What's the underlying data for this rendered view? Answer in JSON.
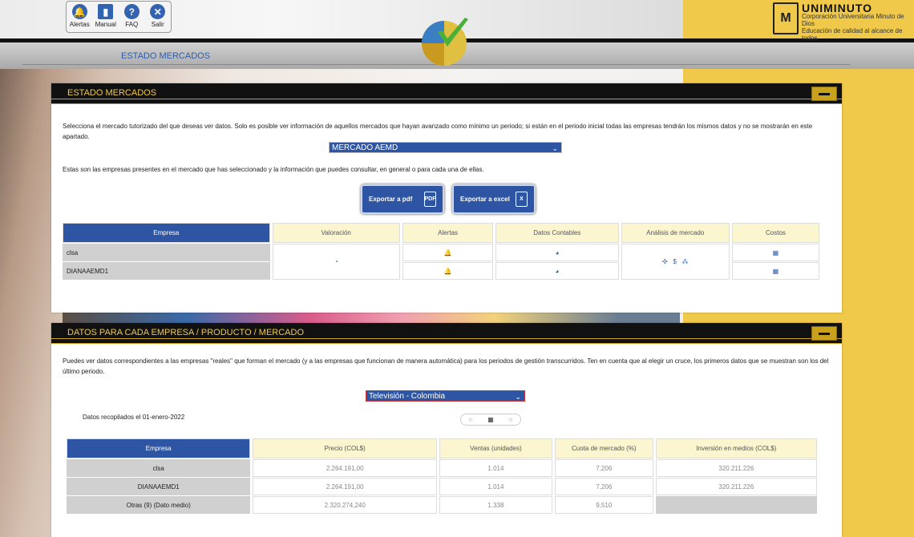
{
  "toolbar": {
    "items": [
      {
        "label": "Alertas",
        "icon": "bell-icon"
      },
      {
        "label": "Manual",
        "icon": "book-icon"
      },
      {
        "label": "FAQ",
        "icon": "question-icon"
      },
      {
        "label": "Salir",
        "icon": "close-icon"
      }
    ]
  },
  "brand": {
    "name": "UNIMINUTO",
    "line1": "Corporación Universitaria Minuto de Dios",
    "line2": "Educación de calidad al alcance de todos"
  },
  "breadcrumb": "ESTADO MERCADOS",
  "panel1": {
    "title": "ESTADO MERCADOS",
    "intro": "Selecciona el mercado tutorizado del que deseas ver datos. Solo es posible ver información de aquellos mercados que hayan avanzado como mínimo un periodo; si están en el periodo inicial todas las empresas tendrán los mismos datos y no se mostrarán en este apartado.",
    "market_select": "MERCADO AEMD",
    "companies_text": "Estas son las empresas presentes en el mercado que has seleccionado y la información que puedes consultar, en general o para cada una de ellas.",
    "export_pdf": "Exportar a pdf",
    "export_excel": "Exportar a excel",
    "pdf_glyph": "PDF",
    "excel_glyph": "X",
    "table": {
      "headers": [
        "Empresa",
        "Valoración",
        "Alertas",
        "Datos Contables",
        "Análisis de mercado",
        "Costos"
      ],
      "rows": [
        "clsa",
        "DIANAAEMD1"
      ]
    }
  },
  "panel2": {
    "title": "DATOS PARA CADA EMPRESA / PRODUCTO / MERCADO",
    "intro": "Puedes ver datos correspondientes a las empresas \"reales\" que forman el mercado (y a las empresas que funcionan de manera automática) para los periodos de gestión transcurridos. Ten en cuenta que al elegir un cruce, los primeros datos que se muestran son los del último periodo.",
    "product_select": "Televisión - Colombia",
    "date_text": "Datos recopilados el 01-enero-2022",
    "table": {
      "headers": [
        "Empresa",
        "Precio (COL$)",
        "Ventas (unidades)",
        "Cuota de mercado (%)",
        "Inversión en medios (COL$)"
      ],
      "rows": [
        {
          "empresa": "clsa",
          "precio": "2.264.191,00",
          "ventas": "1.014",
          "cuota": "7,206",
          "inversion": "320.211.226"
        },
        {
          "empresa": "DIANAAEMD1",
          "precio": "2.264.191,00",
          "ventas": "1.014",
          "cuota": "7,206",
          "inversion": "320.211.226"
        },
        {
          "empresa": "Otras (9) (Dato medio)",
          "precio": "2.320.274,240",
          "ventas": "1.338",
          "cuota": "9,510",
          "inversion": ""
        }
      ]
    }
  },
  "colors": {
    "accent": "#2e55a3",
    "gold": "#f0c94b",
    "header_black": "#111111"
  }
}
